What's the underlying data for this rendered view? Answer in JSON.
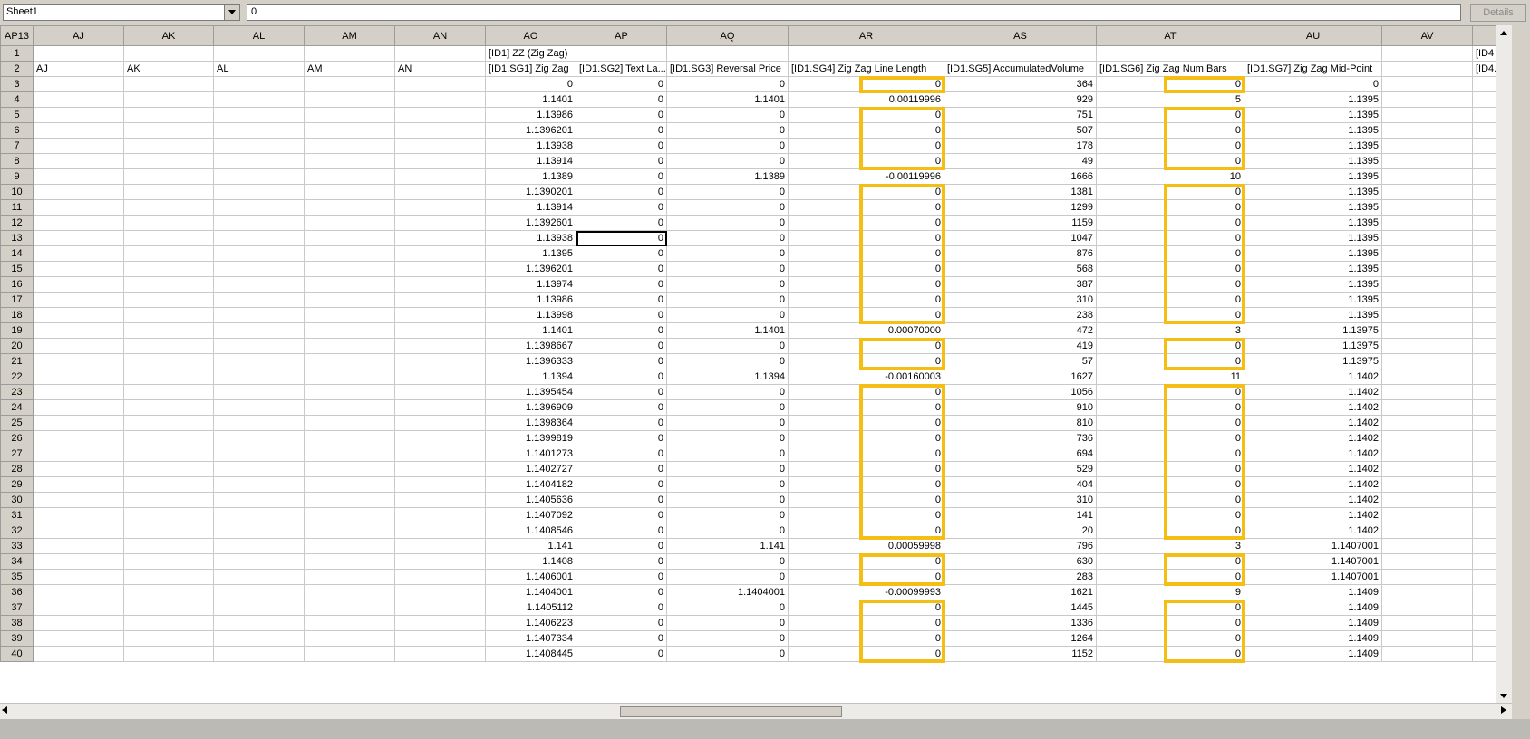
{
  "toolbar": {
    "sheet_name": "Sheet1",
    "formula_value": "0",
    "details_label": "Details"
  },
  "corner_label": "AP13",
  "columns": [
    {
      "label": "AJ",
      "w": 100
    },
    {
      "label": "AK",
      "w": 99
    },
    {
      "label": "AL",
      "w": 100
    },
    {
      "label": "AM",
      "w": 100
    },
    {
      "label": "AN",
      "w": 100
    },
    {
      "label": "AO",
      "w": 100
    },
    {
      "label": "AP",
      "w": 100
    },
    {
      "label": "AQ",
      "w": 134
    },
    {
      "label": "AR",
      "w": 172
    },
    {
      "label": "AS",
      "w": 168
    },
    {
      "label": "AT",
      "w": 163
    },
    {
      "label": "AU",
      "w": 152
    },
    {
      "label": "AV",
      "w": 100
    },
    {
      "label": "",
      "w": 30
    }
  ],
  "rows": [
    {
      "n": "1",
      "c": [
        "",
        "",
        "",
        "",
        "",
        "[ID1] ZZ (Zig Zag)",
        "",
        "",
        "",
        "",
        "",
        "",
        "",
        "[ID4"
      ]
    },
    {
      "n": "2",
      "c": [
        "AJ",
        "AK",
        "AL",
        "AM",
        "AN",
        "[ID1.SG1] Zig Zag",
        "[ID1.SG2] Text La...",
        "[ID1.SG3] Reversal Price",
        "[ID1.SG4] Zig Zag Line Length",
        "[ID1.SG5] AccumulatedVolume",
        "[ID1.SG6] Zig Zag Num Bars",
        "[ID1.SG7] Zig Zag Mid-Point",
        "",
        "[ID4."
      ]
    },
    {
      "n": "3",
      "c": [
        "",
        "",
        "",
        "",
        "",
        "0",
        "0",
        "0",
        "0",
        "364",
        "0",
        "0",
        "",
        ""
      ]
    },
    {
      "n": "4",
      "c": [
        "",
        "",
        "",
        "",
        "",
        "1.1401",
        "0",
        "1.1401",
        "0.00119996",
        "929",
        "5",
        "1.1395",
        "",
        ""
      ]
    },
    {
      "n": "5",
      "c": [
        "",
        "",
        "",
        "",
        "",
        "1.13986",
        "0",
        "0",
        "0",
        "751",
        "0",
        "1.1395",
        "",
        ""
      ]
    },
    {
      "n": "6",
      "c": [
        "",
        "",
        "",
        "",
        "",
        "1.1396201",
        "0",
        "0",
        "0",
        "507",
        "0",
        "1.1395",
        "",
        ""
      ]
    },
    {
      "n": "7",
      "c": [
        "",
        "",
        "",
        "",
        "",
        "1.13938",
        "0",
        "0",
        "0",
        "178",
        "0",
        "1.1395",
        "",
        ""
      ]
    },
    {
      "n": "8",
      "c": [
        "",
        "",
        "",
        "",
        "",
        "1.13914",
        "0",
        "0",
        "0",
        "49",
        "0",
        "1.1395",
        "",
        ""
      ]
    },
    {
      "n": "9",
      "c": [
        "",
        "",
        "",
        "",
        "",
        "1.1389",
        "0",
        "1.1389",
        "-0.00119996",
        "1666",
        "10",
        "1.1395",
        "",
        ""
      ]
    },
    {
      "n": "10",
      "c": [
        "",
        "",
        "",
        "",
        "",
        "1.1390201",
        "0",
        "0",
        "0",
        "1381",
        "0",
        "1.1395",
        "",
        ""
      ]
    },
    {
      "n": "11",
      "c": [
        "",
        "",
        "",
        "",
        "",
        "1.13914",
        "0",
        "0",
        "0",
        "1299",
        "0",
        "1.1395",
        "",
        ""
      ]
    },
    {
      "n": "12",
      "c": [
        "",
        "",
        "",
        "",
        "",
        "1.1392601",
        "0",
        "0",
        "0",
        "1159",
        "0",
        "1.1395",
        "",
        ""
      ]
    },
    {
      "n": "13",
      "c": [
        "",
        "",
        "",
        "",
        "",
        "1.13938",
        "0",
        "0",
        "0",
        "1047",
        "0",
        "1.1395",
        "",
        ""
      ]
    },
    {
      "n": "14",
      "c": [
        "",
        "",
        "",
        "",
        "",
        "1.1395",
        "0",
        "0",
        "0",
        "876",
        "0",
        "1.1395",
        "",
        ""
      ]
    },
    {
      "n": "15",
      "c": [
        "",
        "",
        "",
        "",
        "",
        "1.1396201",
        "0",
        "0",
        "0",
        "568",
        "0",
        "1.1395",
        "",
        ""
      ]
    },
    {
      "n": "16",
      "c": [
        "",
        "",
        "",
        "",
        "",
        "1.13974",
        "0",
        "0",
        "0",
        "387",
        "0",
        "1.1395",
        "",
        ""
      ]
    },
    {
      "n": "17",
      "c": [
        "",
        "",
        "",
        "",
        "",
        "1.13986",
        "0",
        "0",
        "0",
        "310",
        "0",
        "1.1395",
        "",
        ""
      ]
    },
    {
      "n": "18",
      "c": [
        "",
        "",
        "",
        "",
        "",
        "1.13998",
        "0",
        "0",
        "0",
        "238",
        "0",
        "1.1395",
        "",
        ""
      ]
    },
    {
      "n": "19",
      "c": [
        "",
        "",
        "",
        "",
        "",
        "1.1401",
        "0",
        "1.1401",
        "0.00070000",
        "472",
        "3",
        "1.13975",
        "",
        ""
      ]
    },
    {
      "n": "20",
      "c": [
        "",
        "",
        "",
        "",
        "",
        "1.1398667",
        "0",
        "0",
        "0",
        "419",
        "0",
        "1.13975",
        "",
        ""
      ]
    },
    {
      "n": "21",
      "c": [
        "",
        "",
        "",
        "",
        "",
        "1.1396333",
        "0",
        "0",
        "0",
        "57",
        "0",
        "1.13975",
        "",
        ""
      ]
    },
    {
      "n": "22",
      "c": [
        "",
        "",
        "",
        "",
        "",
        "1.1394",
        "0",
        "1.1394",
        "-0.00160003",
        "1627",
        "11",
        "1.1402",
        "",
        ""
      ]
    },
    {
      "n": "23",
      "c": [
        "",
        "",
        "",
        "",
        "",
        "1.1395454",
        "0",
        "0",
        "0",
        "1056",
        "0",
        "1.1402",
        "",
        ""
      ]
    },
    {
      "n": "24",
      "c": [
        "",
        "",
        "",
        "",
        "",
        "1.1396909",
        "0",
        "0",
        "0",
        "910",
        "0",
        "1.1402",
        "",
        ""
      ]
    },
    {
      "n": "25",
      "c": [
        "",
        "",
        "",
        "",
        "",
        "1.1398364",
        "0",
        "0",
        "0",
        "810",
        "0",
        "1.1402",
        "",
        ""
      ]
    },
    {
      "n": "26",
      "c": [
        "",
        "",
        "",
        "",
        "",
        "1.1399819",
        "0",
        "0",
        "0",
        "736",
        "0",
        "1.1402",
        "",
        ""
      ]
    },
    {
      "n": "27",
      "c": [
        "",
        "",
        "",
        "",
        "",
        "1.1401273",
        "0",
        "0",
        "0",
        "694",
        "0",
        "1.1402",
        "",
        ""
      ]
    },
    {
      "n": "28",
      "c": [
        "",
        "",
        "",
        "",
        "",
        "1.1402727",
        "0",
        "0",
        "0",
        "529",
        "0",
        "1.1402",
        "",
        ""
      ]
    },
    {
      "n": "29",
      "c": [
        "",
        "",
        "",
        "",
        "",
        "1.1404182",
        "0",
        "0",
        "0",
        "404",
        "0",
        "1.1402",
        "",
        ""
      ]
    },
    {
      "n": "30",
      "c": [
        "",
        "",
        "",
        "",
        "",
        "1.1405636",
        "0",
        "0",
        "0",
        "310",
        "0",
        "1.1402",
        "",
        ""
      ]
    },
    {
      "n": "31",
      "c": [
        "",
        "",
        "",
        "",
        "",
        "1.1407092",
        "0",
        "0",
        "0",
        "141",
        "0",
        "1.1402",
        "",
        ""
      ]
    },
    {
      "n": "32",
      "c": [
        "",
        "",
        "",
        "",
        "",
        "1.1408546",
        "0",
        "0",
        "0",
        "20",
        "0",
        "1.1402",
        "",
        ""
      ]
    },
    {
      "n": "33",
      "c": [
        "",
        "",
        "",
        "",
        "",
        "1.141",
        "0",
        "1.141",
        "0.00059998",
        "796",
        "3",
        "1.1407001",
        "",
        ""
      ]
    },
    {
      "n": "34",
      "c": [
        "",
        "",
        "",
        "",
        "",
        "1.1408",
        "0",
        "0",
        "0",
        "630",
        "0",
        "1.1407001",
        "",
        ""
      ]
    },
    {
      "n": "35",
      "c": [
        "",
        "",
        "",
        "",
        "",
        "1.1406001",
        "0",
        "0",
        "0",
        "283",
        "0",
        "1.1407001",
        "",
        ""
      ]
    },
    {
      "n": "36",
      "c": [
        "",
        "",
        "",
        "",
        "",
        "1.1404001",
        "0",
        "1.1404001",
        "-0.00099993",
        "1621",
        "9",
        "1.1409",
        "",
        ""
      ]
    },
    {
      "n": "37",
      "c": [
        "",
        "",
        "",
        "",
        "",
        "1.1405112",
        "0",
        "0",
        "0",
        "1445",
        "0",
        "1.1409",
        "",
        ""
      ]
    },
    {
      "n": "38",
      "c": [
        "",
        "",
        "",
        "",
        "",
        "1.1406223",
        "0",
        "0",
        "0",
        "1336",
        "0",
        "1.1409",
        "",
        ""
      ]
    },
    {
      "n": "39",
      "c": [
        "",
        "",
        "",
        "",
        "",
        "1.1407334",
        "0",
        "0",
        "0",
        "1264",
        "0",
        "1.1409",
        "",
        ""
      ]
    },
    {
      "n": "40",
      "c": [
        "",
        "",
        "",
        "",
        "",
        "1.1408445",
        "0",
        "0",
        "0",
        "1152",
        "0",
        "1.1409",
        "",
        ""
      ]
    }
  ],
  "selected_cell": {
    "row": 13,
    "col": 6
  },
  "highlight_color": "#f5be14",
  "highlights": [
    {
      "col": "AR",
      "from": 3,
      "to": 3
    },
    {
      "col": "AT",
      "from": 3,
      "to": 3
    },
    {
      "col": "AR",
      "from": 5,
      "to": 8
    },
    {
      "col": "AT",
      "from": 5,
      "to": 8
    },
    {
      "col": "AR",
      "from": 10,
      "to": 18
    },
    {
      "col": "AT",
      "from": 10,
      "to": 18
    },
    {
      "col": "AR",
      "from": 20,
      "to": 21
    },
    {
      "col": "AT",
      "from": 20,
      "to": 21
    },
    {
      "col": "AR",
      "from": 23,
      "to": 32
    },
    {
      "col": "AT",
      "from": 23,
      "to": 32
    },
    {
      "col": "AR",
      "from": 34,
      "to": 35
    },
    {
      "col": "AT",
      "from": 34,
      "to": 35
    },
    {
      "col": "AR",
      "from": 37,
      "to": 40
    },
    {
      "col": "AT",
      "from": 37,
      "to": 40
    }
  ]
}
